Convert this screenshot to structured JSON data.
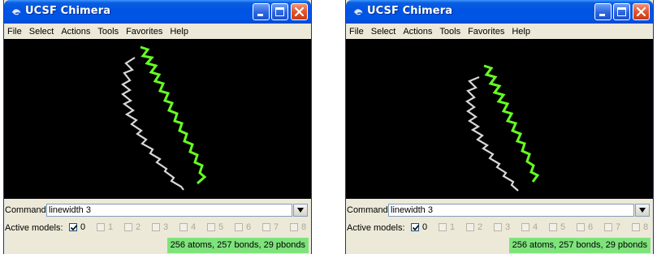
{
  "windows": [
    {
      "title": "UCSF Chimera",
      "menu": [
        "File",
        "Select",
        "Actions",
        "Tools",
        "Favorites",
        "Help"
      ],
      "command_label": "Command:",
      "command_value": "linewidth 3",
      "models_label": "Active models:",
      "models": [
        {
          "label": "0",
          "checked": true,
          "enabled": true
        },
        {
          "label": "1",
          "checked": false,
          "enabled": false
        },
        {
          "label": "2",
          "checked": false,
          "enabled": false
        },
        {
          "label": "3",
          "checked": false,
          "enabled": false
        },
        {
          "label": "4",
          "checked": false,
          "enabled": false
        },
        {
          "label": "5",
          "checked": false,
          "enabled": false
        },
        {
          "label": "6",
          "checked": false,
          "enabled": false
        },
        {
          "label": "7",
          "checked": false,
          "enabled": false
        },
        {
          "label": "8",
          "checked": false,
          "enabled": false
        }
      ],
      "status": "256 atoms, 257 bonds, 29 pbonds",
      "helix_colors": {
        "white": "#d8d8d8",
        "green": "#66ff22"
      }
    },
    {
      "title": "UCSF Chimera",
      "menu": [
        "File",
        "Select",
        "Actions",
        "Tools",
        "Favorites",
        "Help"
      ],
      "command_label": "Command:",
      "command_value": "linewidth 3",
      "models_label": "Active models:",
      "models": [
        {
          "label": "0",
          "checked": true,
          "enabled": true
        },
        {
          "label": "1",
          "checked": false,
          "enabled": false
        },
        {
          "label": "2",
          "checked": false,
          "enabled": false
        },
        {
          "label": "3",
          "checked": false,
          "enabled": false
        },
        {
          "label": "4",
          "checked": false,
          "enabled": false
        },
        {
          "label": "5",
          "checked": false,
          "enabled": false
        },
        {
          "label": "6",
          "checked": false,
          "enabled": false
        },
        {
          "label": "7",
          "checked": false,
          "enabled": false
        },
        {
          "label": "8",
          "checked": false,
          "enabled": false
        }
      ],
      "status": "256 atoms, 257 bonds, 29 pbonds",
      "helix_colors": {
        "white": "#d8d8d8",
        "green": "#66ff22"
      }
    }
  ]
}
